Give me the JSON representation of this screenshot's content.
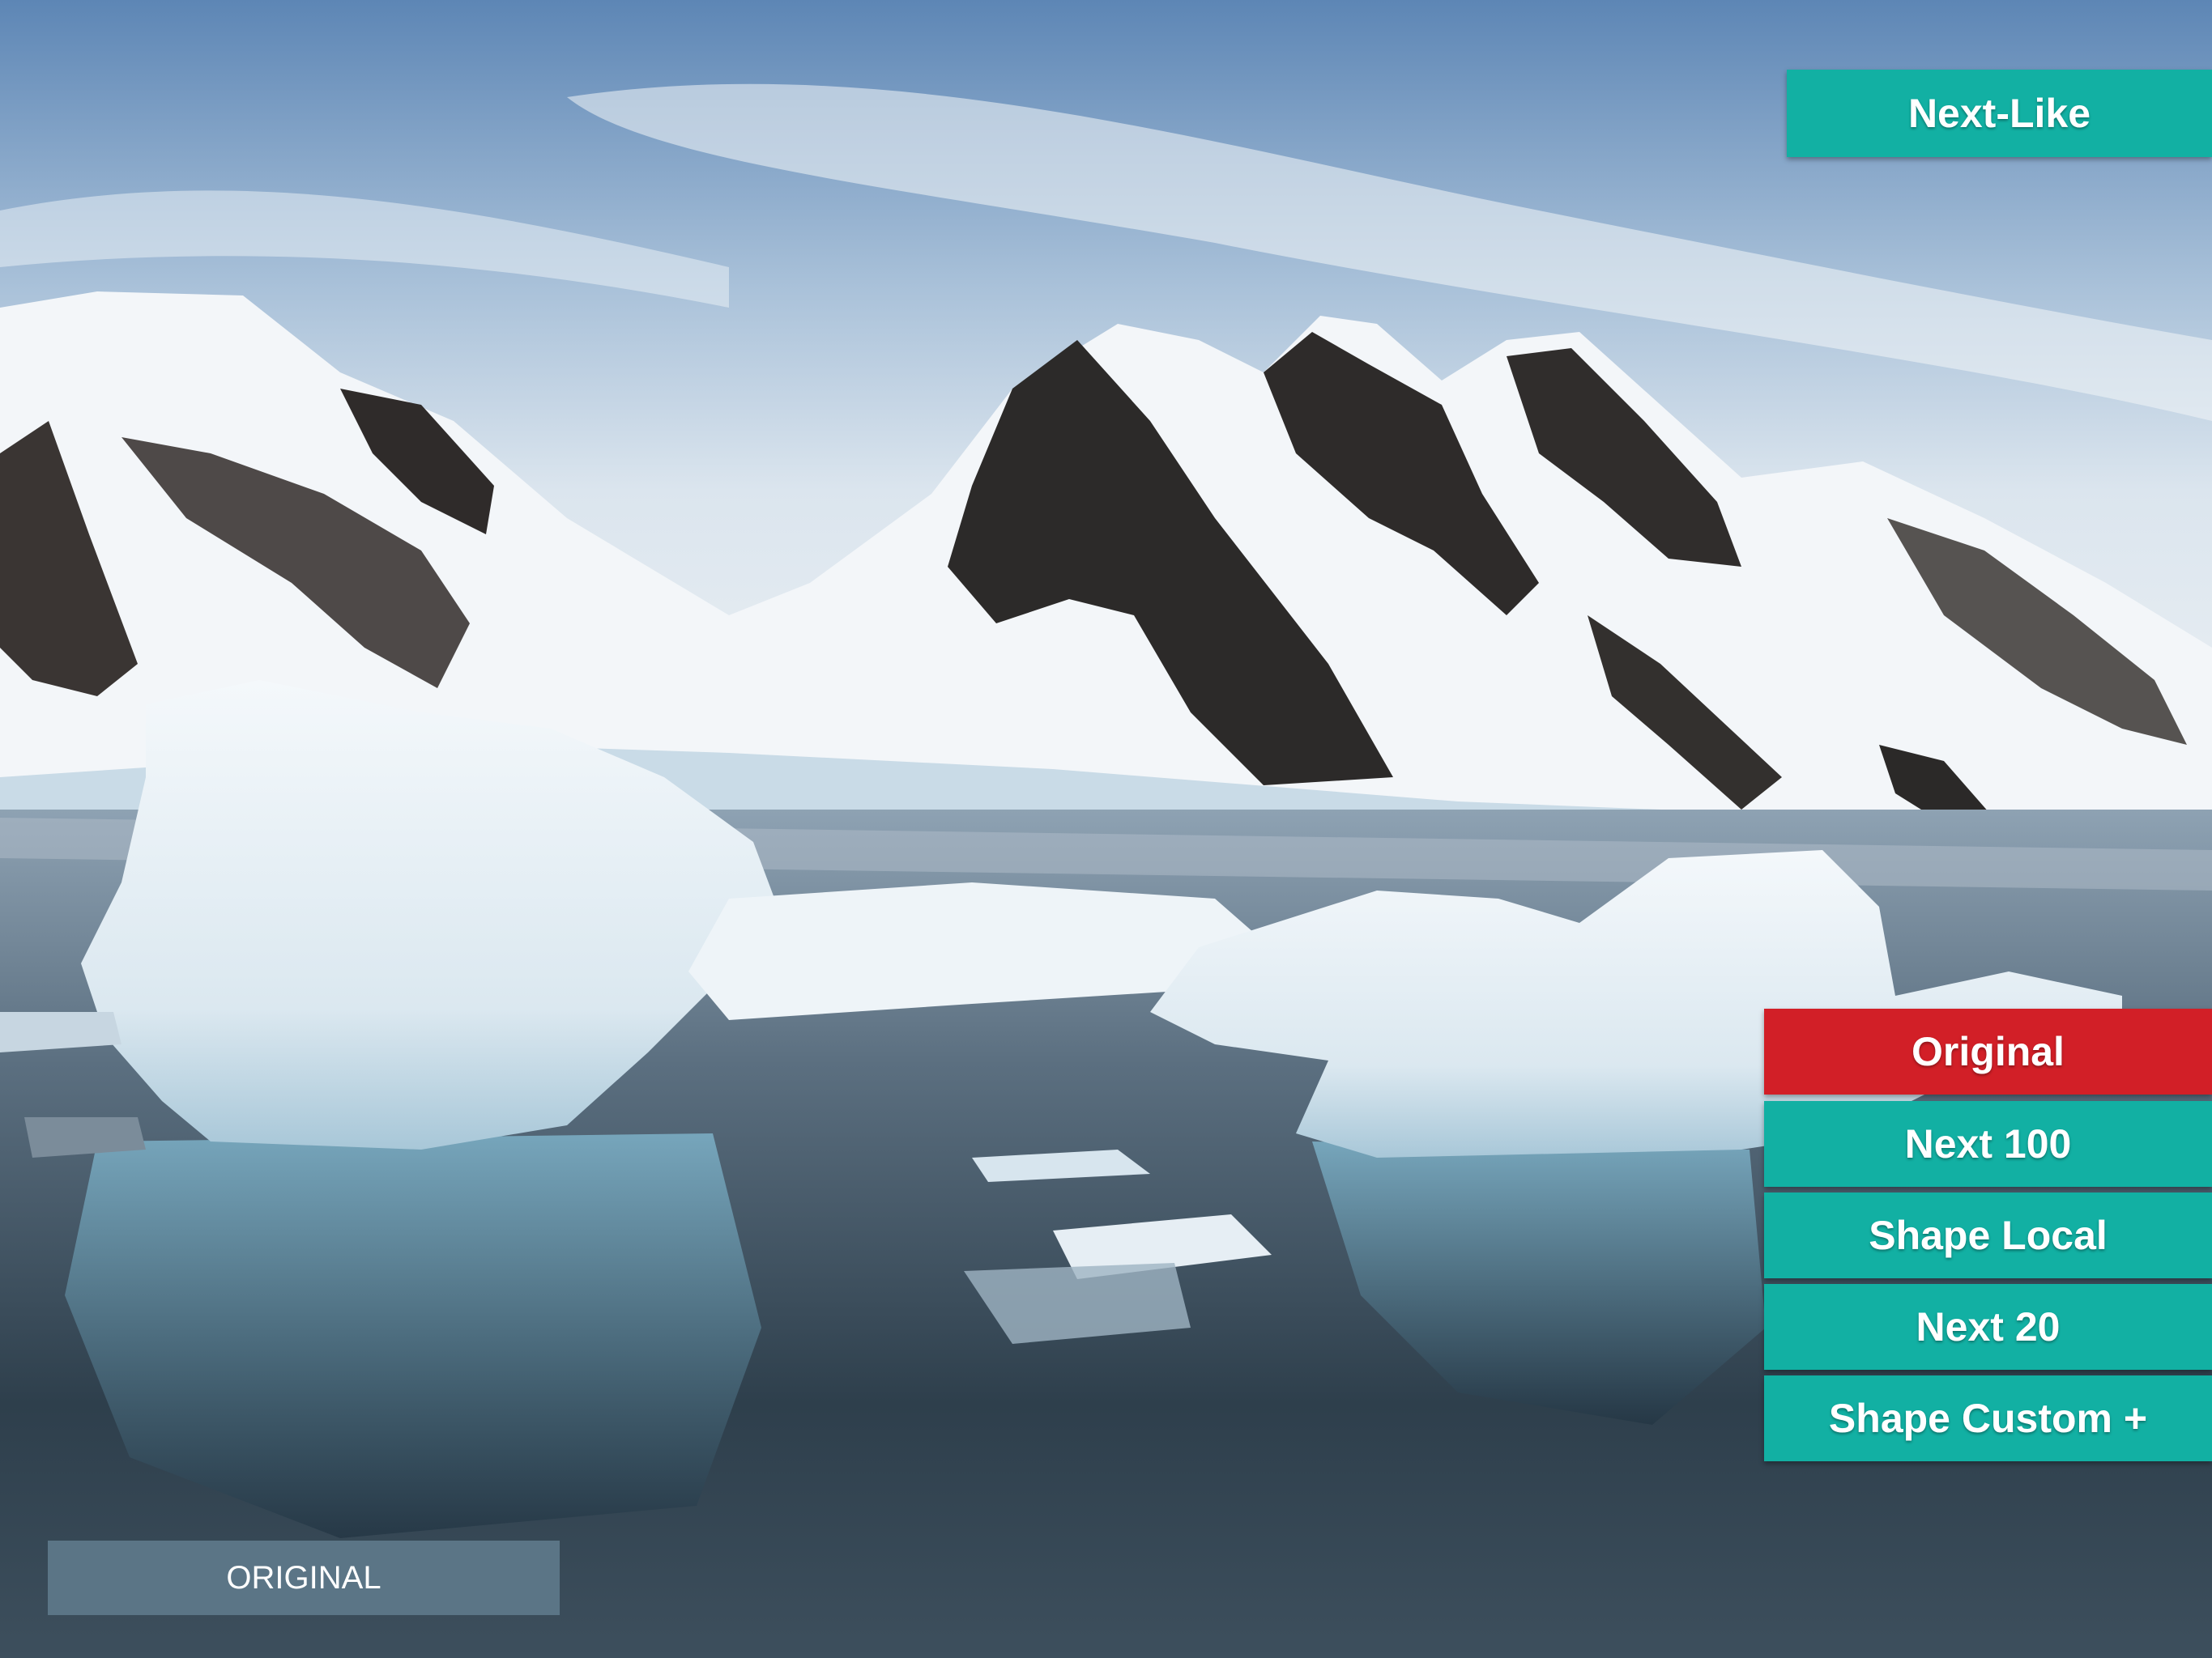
{
  "colors": {
    "teal": "#12b0a3",
    "active_red": "#d21f27",
    "label_bg": "#5b7586"
  },
  "top_button": {
    "label": "Next-Like"
  },
  "menu": {
    "items": [
      {
        "label": "Original",
        "active": true
      },
      {
        "label": "Next 100",
        "active": false
      },
      {
        "label": "Shape Local",
        "active": false
      },
      {
        "label": "Next 20",
        "active": false
      },
      {
        "label": "Shape Custom +",
        "active": false
      }
    ]
  },
  "mode_label": {
    "text": "ORIGINAL"
  }
}
